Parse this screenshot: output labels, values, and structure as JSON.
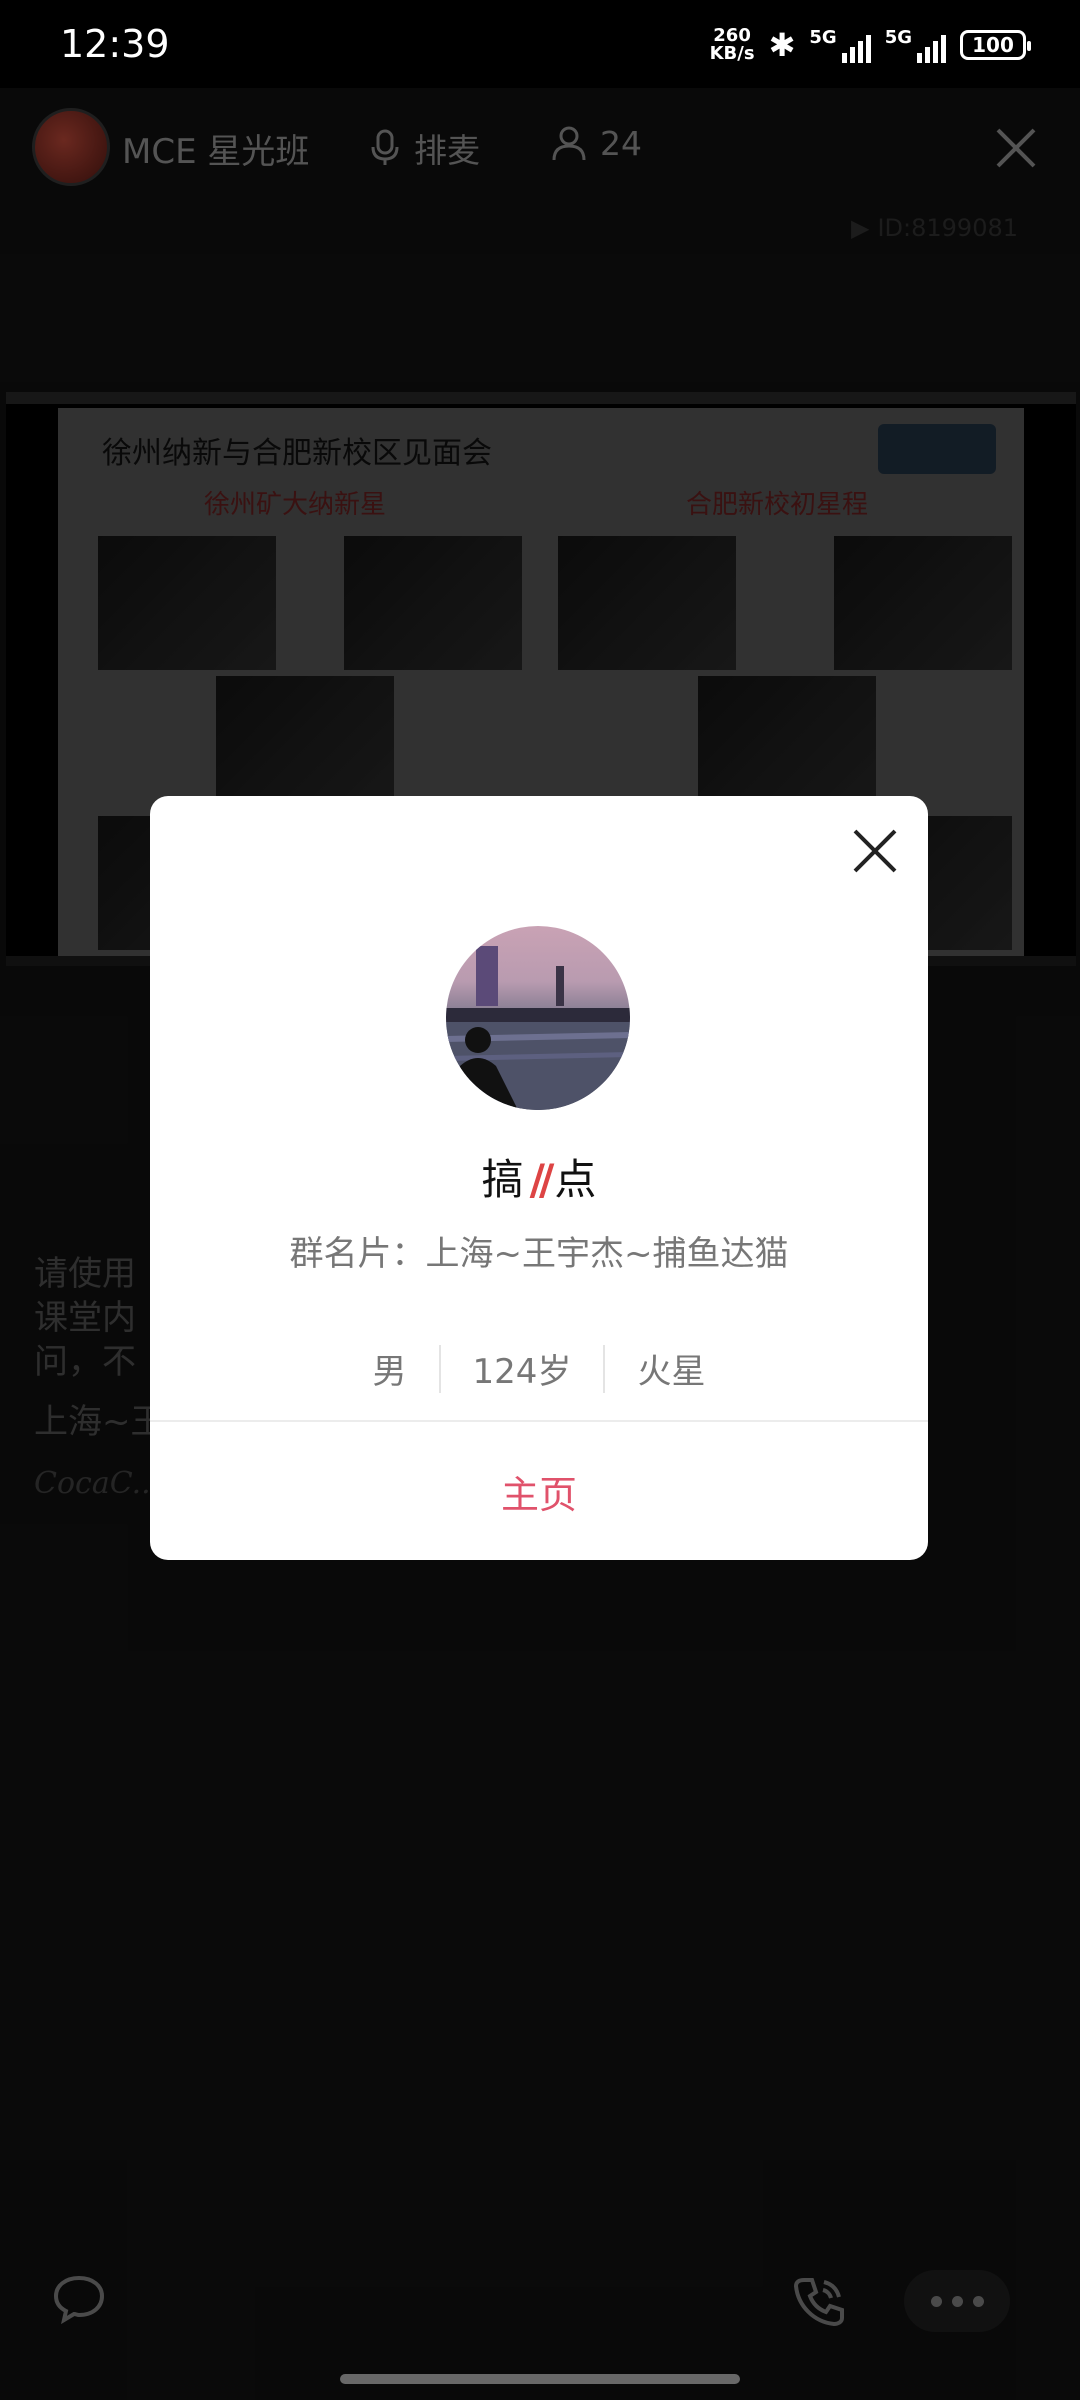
{
  "status_bar": {
    "time": "12:39",
    "net_speed_value": "260",
    "net_speed_unit": "KB/s",
    "signal1": "5G",
    "signal2": "5G",
    "battery": "100"
  },
  "header": {
    "room_name": "MCE 星光班",
    "mic_label": "排麦",
    "online_count": "24",
    "room_id": "ID:8199081"
  },
  "slide": {
    "title": "徐州纳新与合肥新校区见面会",
    "left_caption": "徐州矿大纳新星",
    "right_caption": "合肥新校初星程"
  },
  "chat": {
    "line1": "请使用",
    "line2": "课堂内",
    "line3": "问，不",
    "line4": "上海~王",
    "signature": "CocaC..."
  },
  "profile_card": {
    "nickname_left": "搞",
    "nickname_mid": "//",
    "nickname_right": "点",
    "group_card": "群名片：上海~王宇杰~捕鱼达猫",
    "gender": "男",
    "age": "124岁",
    "location": "火星",
    "homepage_label": "主页",
    "accent_color": "#e0526b"
  }
}
